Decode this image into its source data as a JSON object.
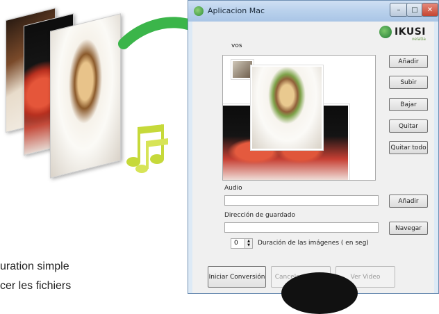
{
  "illustration": {
    "caption_lines": [
      "uration simple",
      "cer les fichiers"
    ]
  },
  "colors": {
    "arrow_green": "#3bb54a",
    "note_green": "#c6d93a",
    "window_frame": "#ddeaf6"
  },
  "window": {
    "title": "Aplicacion Mac",
    "controls": {
      "minimize": "–",
      "maximize": "□",
      "close": "✕"
    },
    "logo": {
      "text": "IKUSI",
      "subtitle": "velatia"
    }
  },
  "images_section": {
    "label": "vos",
    "buttons": {
      "add": "Añadir",
      "up": "Subir",
      "down": "Bajar",
      "remove": "Quitar",
      "remove_all": "Quitar todo"
    }
  },
  "audio": {
    "label": "Audio",
    "value": "",
    "add_button": "Añadir"
  },
  "save": {
    "label": "Dirección de guardado",
    "value": "",
    "browse_button": "Navegar"
  },
  "duration": {
    "value": "0",
    "label": "Duración de las imágenes ( en seg)"
  },
  "actions": {
    "start": "Iniciar Conversión",
    "cancel": "Cancelar Conver",
    "view": "Ver Video"
  }
}
